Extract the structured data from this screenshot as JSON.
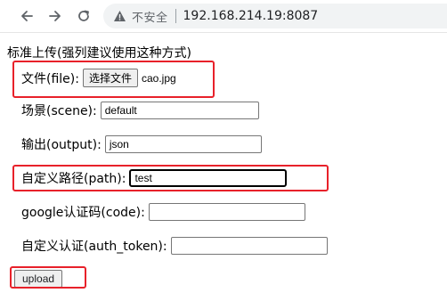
{
  "browser": {
    "security_label": "不安全",
    "url": "192.168.214.19:8087"
  },
  "form": {
    "section_title": "标准上传(强列建议使用这种方式)",
    "file": {
      "label": "文件(file):",
      "button_label": "选择文件",
      "file_name": "cao.jpg"
    },
    "scene": {
      "label": "场景(scene):",
      "value": "default"
    },
    "output": {
      "label": "输出(output):",
      "value": "json"
    },
    "path": {
      "label": "自定义路径(path):",
      "value": "test"
    },
    "code": {
      "label": "google认证码(code):",
      "value": ""
    },
    "auth_token": {
      "label": "自定义认证(auth_token):",
      "value": ""
    },
    "submit_label": "upload"
  },
  "colors": {
    "annotation": "#e8212a"
  }
}
